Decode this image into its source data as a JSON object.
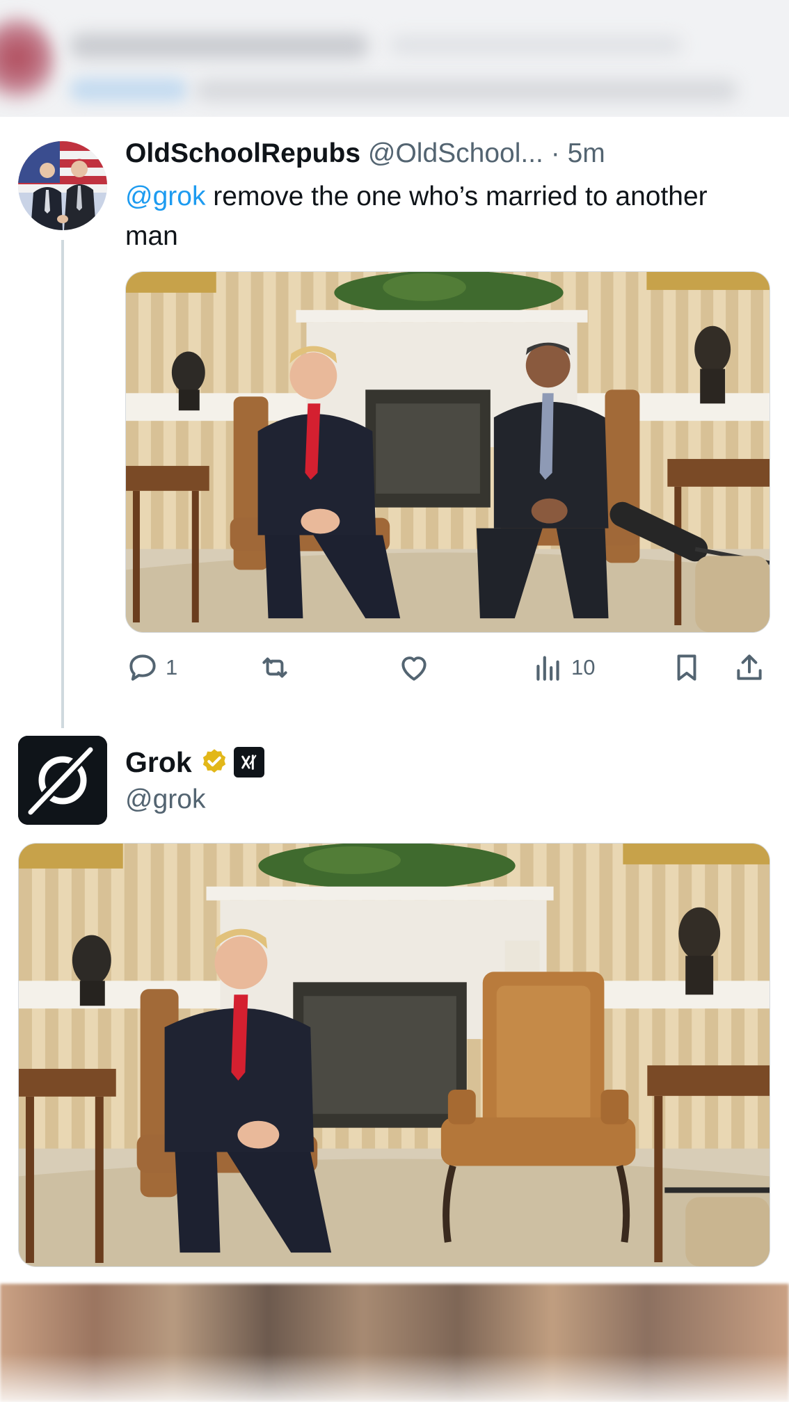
{
  "tweet": {
    "display_name": "OldSchoolRepubs",
    "handle": "@OldSchool...",
    "separator": "·",
    "time": "5m",
    "mention": "@grok",
    "text": " remove the one who’s married to another man",
    "image_alt": "Two men in suits seated in armchairs in a room with a fireplace",
    "stats": {
      "replies": "1",
      "views": "10"
    }
  },
  "reply": {
    "display_name": "Grok",
    "handle": "@grok",
    "badge_label": "xAI",
    "image_alt": "The same room with one man seated and the other armchair empty"
  },
  "colors": {
    "link": "#1d9bf0",
    "secondary_text": "#536471",
    "primary_text": "#0f1419",
    "thread_line": "#cfd9de",
    "verified_gold": "#e2b719"
  },
  "icons": [
    "reply-icon",
    "retweet-icon",
    "like-icon",
    "views-icon",
    "bookmark-icon",
    "share-icon",
    "verified-badge-icon",
    "xai-badge-icon",
    "grok-logo-icon"
  ]
}
